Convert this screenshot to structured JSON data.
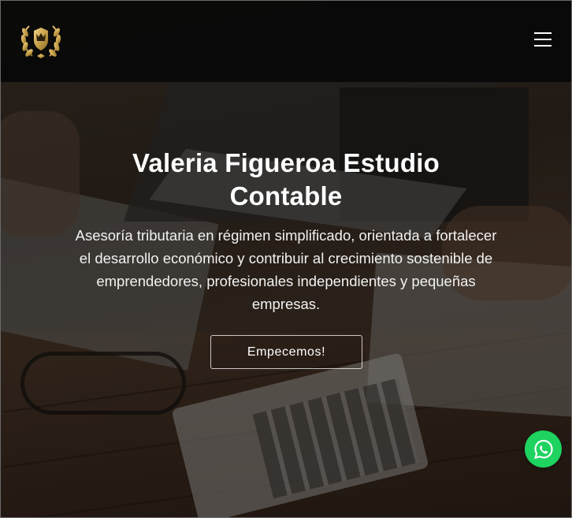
{
  "header": {
    "logo_icon": "laurel-crest-logo-icon",
    "menu_icon": "hamburger-menu-icon"
  },
  "hero": {
    "title": "Valeria Figueroa Estudio Contable",
    "description": "Asesoría tributaria en régimen simplificado, orientada a fortalecer el desarrollo económico y contribuir al crecimiento sostenible de emprendedores, profesionales independientes y pequeñas empresas.",
    "cta_label": "Empecemos!"
  },
  "floating": {
    "whatsapp_icon": "whatsapp-icon"
  },
  "colors": {
    "header_bg": "#080808",
    "whatsapp_green": "#1ed35f",
    "logo_gold": "#c9a24a",
    "text": "#ffffff"
  }
}
